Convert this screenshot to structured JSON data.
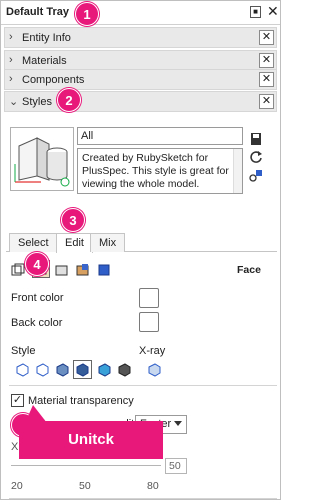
{
  "tray": {
    "title": "Default Tray"
  },
  "sections": [
    {
      "label": "Entity Info",
      "expanded": false
    },
    {
      "label": "Materials",
      "expanded": false
    },
    {
      "label": "Components",
      "expanded": false
    },
    {
      "label": "Styles",
      "expanded": true
    }
  ],
  "styles": {
    "name": "All",
    "description": "Created by RubySketch for PlusSpec. This style is great for viewing the whole model."
  },
  "tabs": [
    {
      "label": "Select",
      "active": false
    },
    {
      "label": "Edit",
      "active": true
    },
    {
      "label": "Mix",
      "active": false
    }
  ],
  "face": {
    "label": "Face",
    "front_color": "Front color",
    "back_color": "Back color",
    "style_label": "Style",
    "xray_label": "X-ray",
    "material_transparency": "Material transparency",
    "material_transparency_checked": true,
    "transparency_quality_label": "Transparency quality:",
    "transparency_quality_value": "Faster",
    "slider_value": "50",
    "ticks": [
      "20",
      "50",
      "80"
    ]
  },
  "annotations": {
    "badges": [
      "1",
      "2",
      "3",
      "4",
      "5"
    ],
    "callout": "Unitck"
  },
  "colors": {
    "accent": "#e8187b",
    "section_bg": "#e9e9e9"
  },
  "icons": [
    "close-icon",
    "pin-icon",
    "chevron-right-icon",
    "chevron-down-icon",
    "refresh-icon",
    "save-style-icon",
    "create-style-icon"
  ]
}
